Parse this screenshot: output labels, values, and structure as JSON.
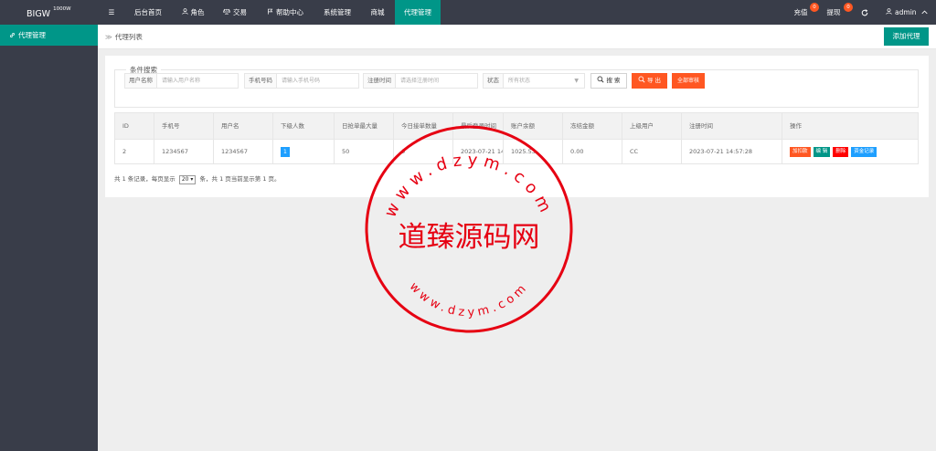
{
  "topbar": {
    "logo_text": "BIGW",
    "logo_sup": "1000W",
    "menu_toggle": "☰",
    "nav": [
      {
        "label": "后台首页",
        "icon": ""
      },
      {
        "label": "角色",
        "icon": "user-icon"
      },
      {
        "label": "交易",
        "icon": "balance-icon"
      },
      {
        "label": "帮助中心",
        "icon": "flag-icon"
      },
      {
        "label": "系统管理",
        "icon": ""
      },
      {
        "label": "商城",
        "icon": ""
      },
      {
        "label": "代理管理",
        "icon": "",
        "active": true
      }
    ],
    "recharge": {
      "label": "充值",
      "count": "0"
    },
    "withdraw": {
      "label": "提现",
      "count": "0"
    },
    "refresh_icon": "refresh-icon",
    "user": "admin"
  },
  "sidebar": {
    "items": [
      {
        "label": "代理管理",
        "icon": "link-icon"
      }
    ]
  },
  "breadcrumb": {
    "sep": "≫",
    "current": "代理列表"
  },
  "toolbar": {
    "add_label": "添加代理"
  },
  "search": {
    "legend": "条件搜索",
    "username": {
      "label": "用户名称",
      "placeholder": "请输入用户名称"
    },
    "phone": {
      "label": "手机号码",
      "placeholder": "请输入手机号码"
    },
    "regtime": {
      "label": "注册时间",
      "placeholder": "请选择注册时间"
    },
    "status": {
      "label": "状态",
      "value": "所有状态"
    },
    "search_label": "搜 索",
    "export_label": "导 出",
    "approve_label": "全部审核"
  },
  "table": {
    "headers": [
      "ID",
      "手机号",
      "用户名",
      "下级人数",
      "日抢单最大量",
      "今日接单数量",
      "最后登录时间",
      "账户余额",
      "冻结金额",
      "上级用户",
      "注册时间",
      "操作"
    ],
    "rows": [
      {
        "id": "2",
        "phone": "1234567",
        "username": "1234567",
        "sub_count": "1",
        "daily_max": "50",
        "today_orders": "0",
        "last_login": "2023-07-21 14:57:28",
        "balance": "1025.53",
        "frozen": "0.00",
        "parent": "CC",
        "reg_time": "2023-07-21 14:57:28",
        "actions": [
          "加扣款",
          "编 辑",
          "删除",
          "资金记录"
        ]
      }
    ]
  },
  "pager": {
    "prefix": "共 1 条记录，每页显示",
    "page_size": "20",
    "suffix": "条，共 1 页当前显示第 1 页。"
  },
  "watermark": {
    "ring_top": "www.dzym.com",
    "center": "道臻源码网",
    "ring_bottom": "www.dzym.com"
  },
  "colors": {
    "topbar": "#393d49",
    "accent": "#009688",
    "danger": "#ff5722",
    "info": "#1e9fff",
    "seal": "#e60012"
  }
}
